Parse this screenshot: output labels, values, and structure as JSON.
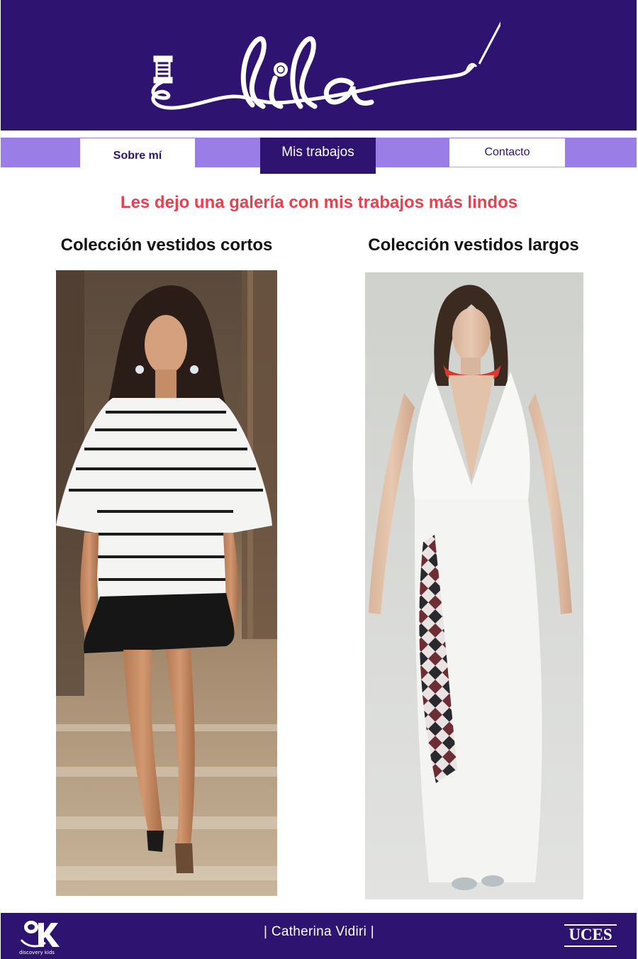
{
  "header": {
    "logo_text": "lila"
  },
  "nav": {
    "items": [
      {
        "label": "Sobre mí"
      },
      {
        "label": "Mis trabajos"
      },
      {
        "label": "Contacto"
      }
    ]
  },
  "main": {
    "subtitle": "Les dejo una galería con mis trabajos más lindos",
    "collections": [
      {
        "title": "Colección vestidos cortos"
      },
      {
        "title": "Colección vestidos largos"
      }
    ]
  },
  "footer": {
    "credit": "| Catherina Vidiri |",
    "left_logo_text": "discovery kids",
    "right_logo_text": "UCES"
  },
  "colors": {
    "brand_purple": "#2e1470",
    "nav_lilac": "#9a7de6",
    "accent_red": "#e8404c"
  }
}
